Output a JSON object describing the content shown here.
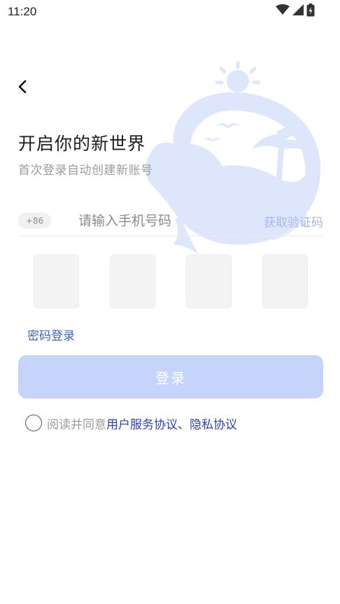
{
  "status_bar": {
    "time": "11:20"
  },
  "header": {
    "title": "开启你的新世界",
    "subtitle": "首次登录自动创建新账号"
  },
  "form": {
    "country_code": "+86",
    "phone_placeholder": "请输入手机号码",
    "phone_value": "",
    "get_code_label": "获取验证码",
    "code_boxes": [
      "",
      "",
      "",
      ""
    ],
    "password_login_label": "密码登录",
    "login_button_label": "登录"
  },
  "agreement": {
    "prefix": "阅读并同意",
    "user_agreement": "用户服务协议",
    "separator": "、",
    "privacy_policy": "隐私协议"
  },
  "icons": [
    "wifi-icon",
    "cellular-signal-icon",
    "battery-icon",
    "back-arrow-icon",
    "whale-island-watermark"
  ],
  "colors": {
    "accent": "#3b64c8",
    "button_disabled": "#c6d4fb",
    "link": "#2e3fb4",
    "get_code": "#a7b7f4",
    "watermark": "#dde6fb"
  }
}
